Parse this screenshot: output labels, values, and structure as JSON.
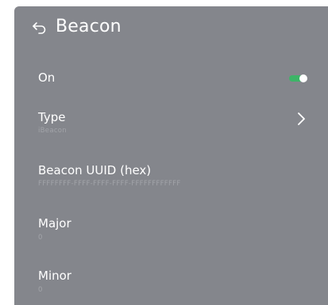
{
  "header": {
    "title": "Beacon",
    "back_icon": "back-arrow-icon"
  },
  "settings": {
    "on": {
      "label": "On",
      "state": true,
      "accent": "#3db467"
    },
    "type": {
      "label": "Type",
      "value": "iBeacon",
      "icon": "chevron-right-icon"
    },
    "uuid": {
      "label": "Beacon UUID (hex)",
      "value": "FFFFFFFF-FFFF-FFFF-FFFF-FFFFFFFFFFFF"
    },
    "major": {
      "label": "Major",
      "value": "0"
    },
    "minor": {
      "label": "Minor",
      "value": "0"
    }
  },
  "colors": {
    "panel": "#84868c",
    "text": "#ffffff",
    "subtext": "#a2a4a9"
  }
}
